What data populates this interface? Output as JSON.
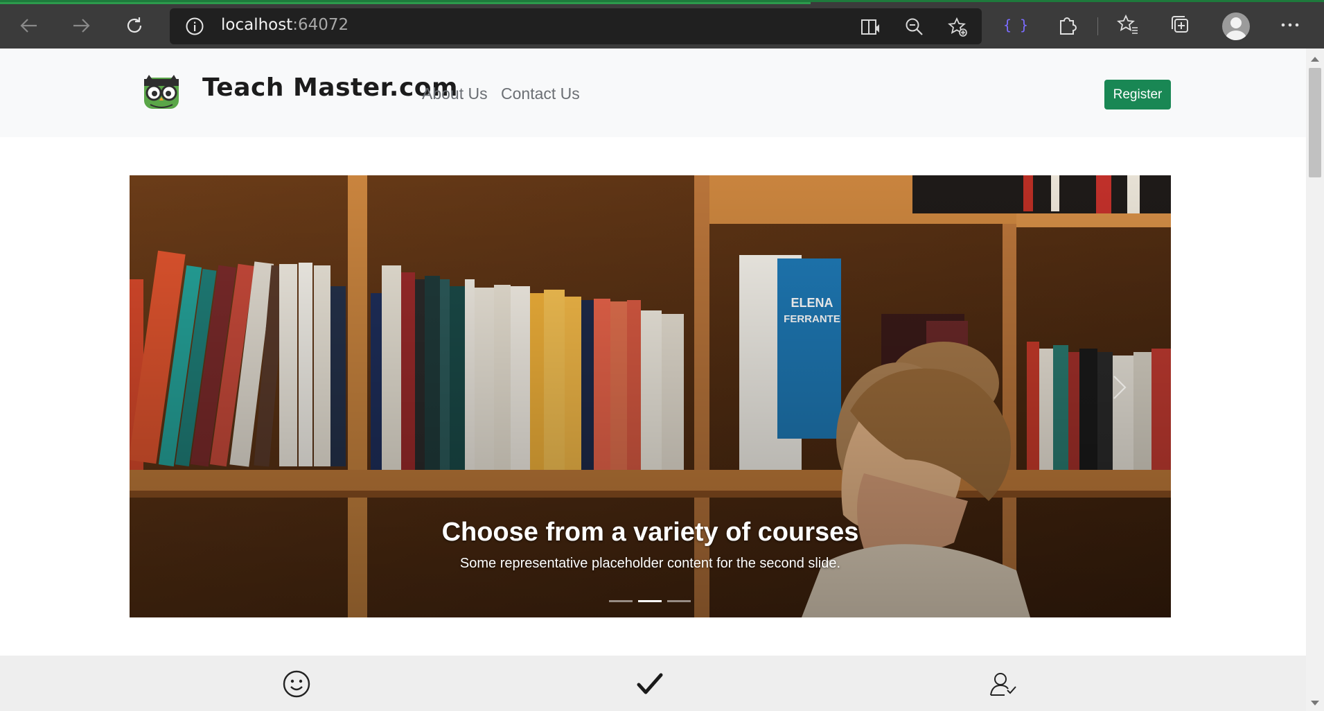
{
  "browser": {
    "url_host": "localhost",
    "url_port": ":64072",
    "icons": [
      "back-icon",
      "forward-icon",
      "refresh-icon",
      "info-icon",
      "immersive-reader-icon",
      "zoom-out-icon",
      "add-favorite-icon",
      "devtools-extension-icon",
      "extensions-icon",
      "favorites-icon",
      "collections-icon",
      "profile-icon",
      "more-icon"
    ]
  },
  "site": {
    "brand": "Teach Master.com",
    "nav": {
      "about": "About Us",
      "contact": "Contact Us"
    },
    "register_label": "Register",
    "colors": {
      "register": "#198754",
      "nav_bg": "#f8f9fa"
    }
  },
  "carousel": {
    "title": "Choose from a variety of courses",
    "subtitle": "Some representative placeholder content for the second slide.",
    "slide_count": 3,
    "active_slide": 2
  },
  "features": {
    "icons": [
      "smile-icon",
      "checkmark-icon",
      "person-check-icon"
    ]
  }
}
